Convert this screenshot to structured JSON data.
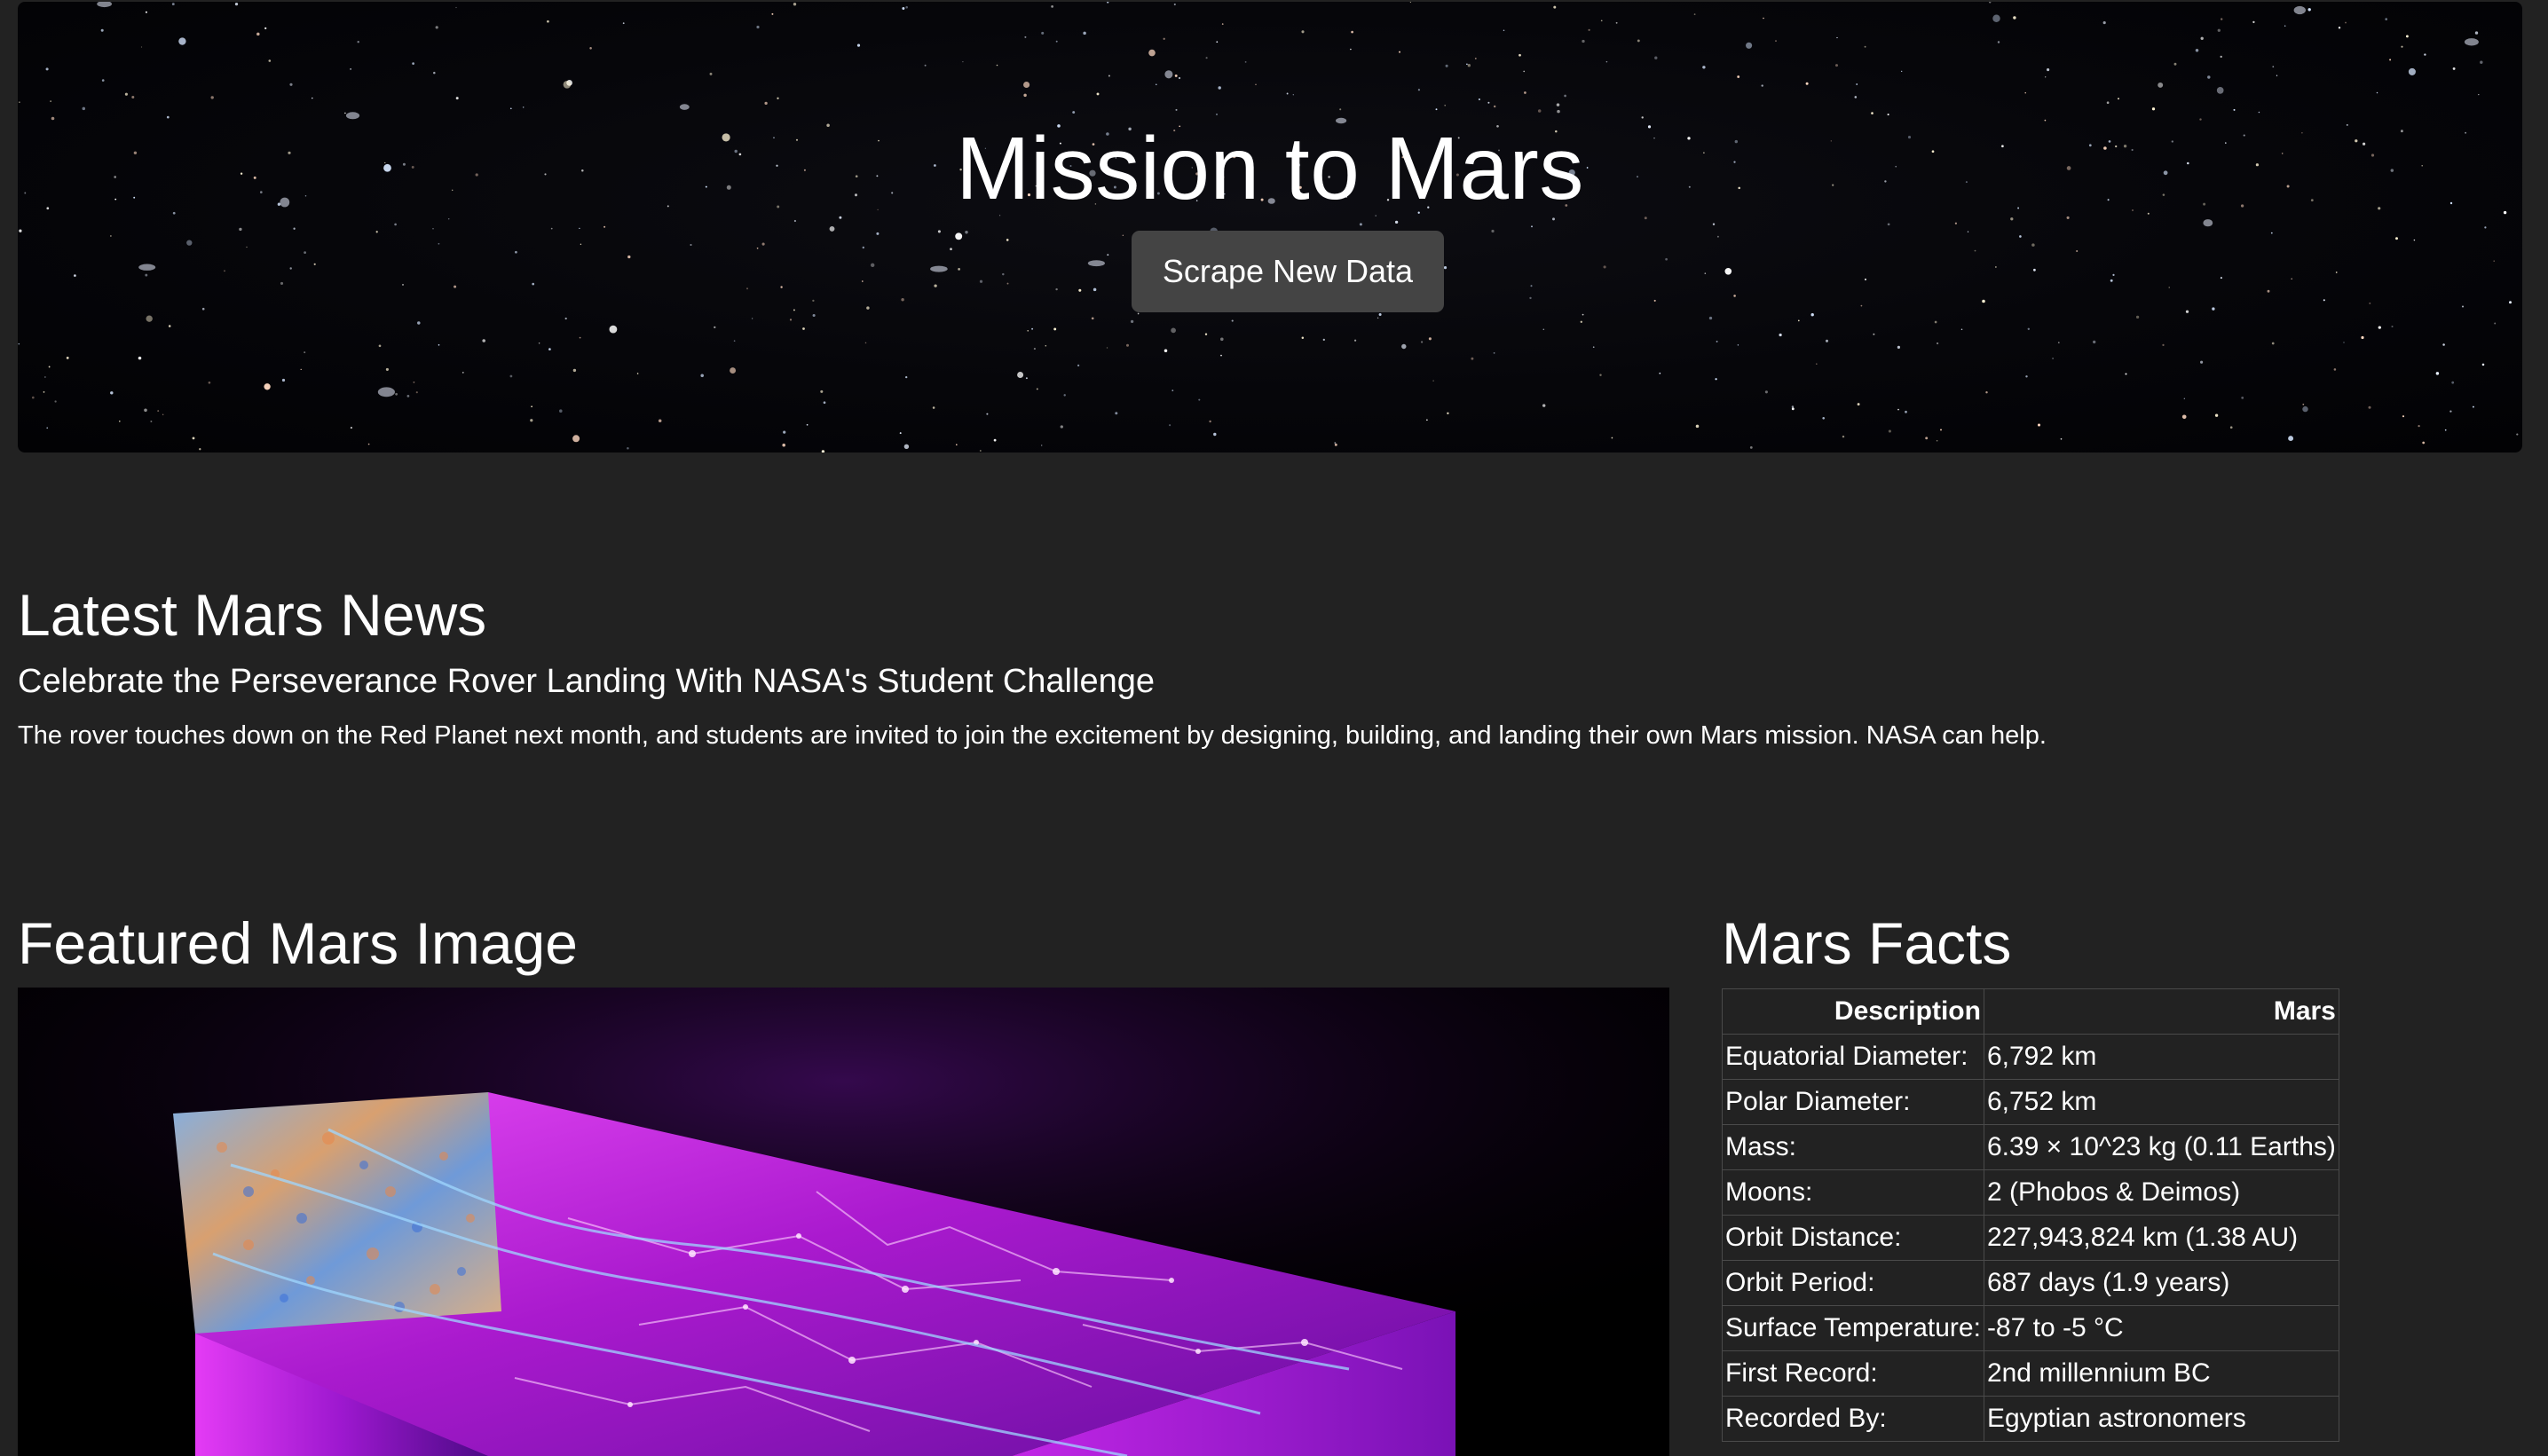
{
  "hero": {
    "title": "Mission to Mars",
    "button_label": "Scrape New Data"
  },
  "news": {
    "heading": "Latest Mars News",
    "title": "Celebrate the Perseverance Rover Landing With NASA's Student Challenge",
    "teaser": "The rover touches down on the Red Planet next month, and students are invited to join the excitement by designing, building, and landing their own Mars mission. NASA can help."
  },
  "featured": {
    "heading": "Featured Mars Image"
  },
  "facts": {
    "heading": "Mars Facts",
    "columns": [
      "Description",
      "Mars"
    ],
    "rows": [
      [
        "Equatorial Diameter:",
        "6,792 km"
      ],
      [
        "Polar Diameter:",
        "6,752 km"
      ],
      [
        "Mass:",
        "6.39 × 10^23 kg (0.11 Earths)"
      ],
      [
        "Moons:",
        "2 (Phobos & Deimos)"
      ],
      [
        "Orbit Distance:",
        "227,943,824 km (1.38 AU)"
      ],
      [
        "Orbit Period:",
        "687 days (1.9 years)"
      ],
      [
        "Surface Temperature:",
        "-87 to -5 °C"
      ],
      [
        "First Record:",
        "2nd millennium BC"
      ],
      [
        "Recorded By:",
        "Egyptian astronomers"
      ]
    ]
  },
  "colors": {
    "page_background": "#222222",
    "button_background": "#444444",
    "table_border": "#4a4a4a",
    "image_glow": "#e040fb"
  }
}
